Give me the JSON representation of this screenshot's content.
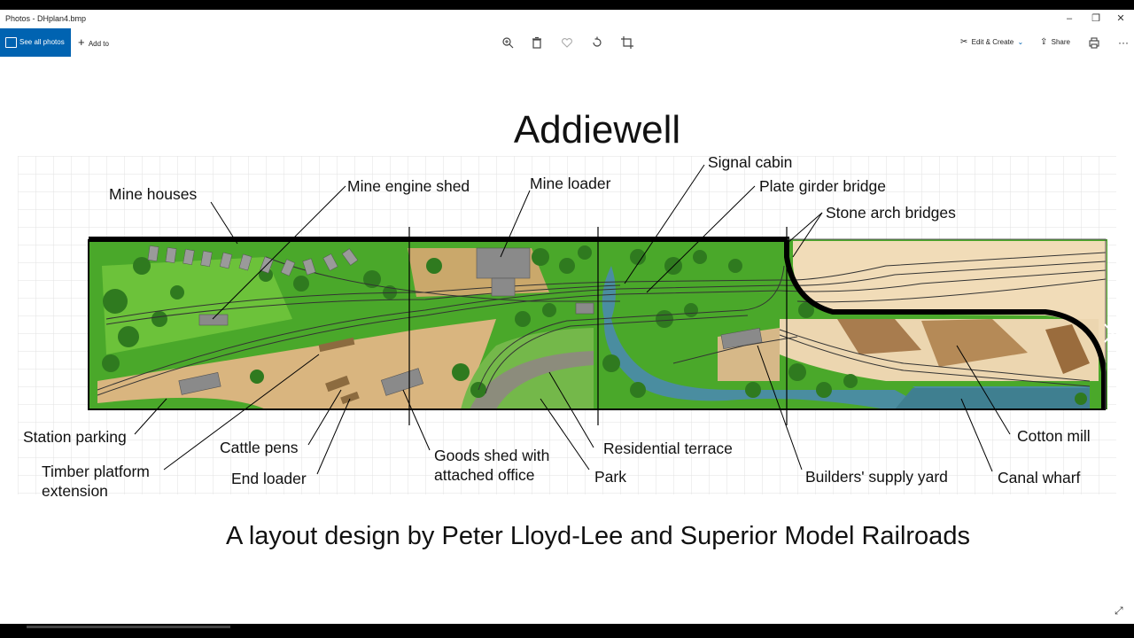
{
  "window": {
    "title": "Photos - DHplan4.bmp"
  },
  "toolbar": {
    "see_all_label": "See all photos",
    "add_to_label": "Add to",
    "edit_create_label": "Edit & Create",
    "share_label": "Share"
  },
  "image": {
    "title": "Addiewell",
    "credit": "A layout design by Peter Lloyd-Lee and Superior Model Railroads",
    "labels": {
      "mine_houses": "Mine houses",
      "mine_engine_shed": "Mine engine shed",
      "mine_loader": "Mine loader",
      "signal_cabin": "Signal cabin",
      "plate_girder_bridge": "Plate girder bridge",
      "stone_arch_bridges": "Stone arch bridges",
      "station_parking": "Station parking",
      "timber_platform_1": "Timber platform",
      "timber_platform_2": "extension",
      "cattle_pens": "Cattle pens",
      "end_loader": "End loader",
      "goods_shed_1": "Goods shed with",
      "goods_shed_2": "attached office",
      "residential_terrace": "Residential terrace",
      "park": "Park",
      "builders_supply_yard": "Builders' supply yard",
      "cotton_mill": "Cotton mill",
      "canal_wharf": "Canal wharf"
    }
  },
  "colors": {
    "accent": "#0063b1",
    "grass": "#4aa82a",
    "trees": "#2f7a1f",
    "dirt": "#d9b57f",
    "water": "#4a8da0",
    "sand": "#f1dcb8"
  }
}
